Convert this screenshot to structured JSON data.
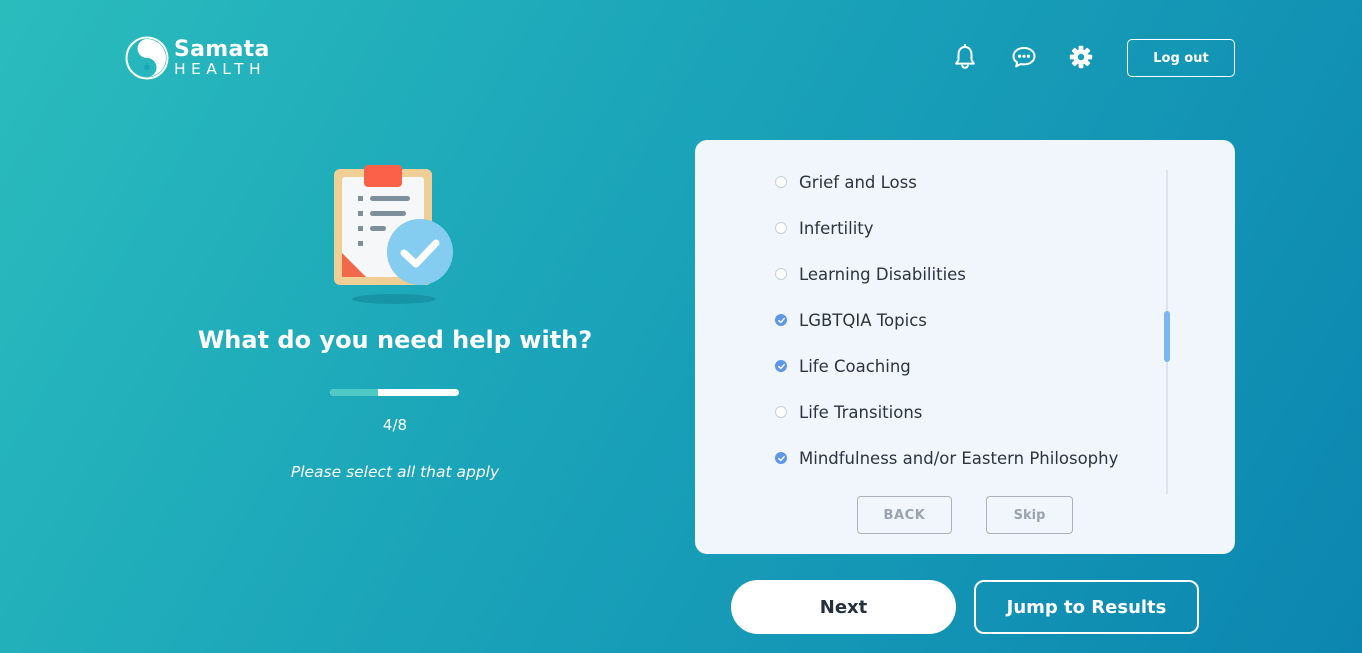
{
  "brand": {
    "name": "Samata",
    "subtitle": "HEALTH"
  },
  "header": {
    "icons": [
      "bell-icon",
      "chat-icon",
      "gear-icon"
    ],
    "logout_label": "Log out"
  },
  "questionnaire": {
    "heading": "What do you need help with?",
    "progress": {
      "current": 4,
      "total": 8,
      "fraction": 0.375,
      "label": "4/8"
    },
    "hint": "Please select all that apply"
  },
  "options": [
    {
      "label": "Grief and Loss",
      "checked": false
    },
    {
      "label": "Infertility",
      "checked": false
    },
    {
      "label": "Learning Disabilities",
      "checked": false
    },
    {
      "label": "LGBTQIA Topics",
      "checked": true
    },
    {
      "label": "Life Coaching",
      "checked": true
    },
    {
      "label": "Life Transitions",
      "checked": false
    },
    {
      "label": "Mindfulness and/or Eastern Philosophy",
      "checked": true
    }
  ],
  "card_buttons": {
    "back_label": "BACK",
    "skip_label": "Skip"
  },
  "actions": {
    "next_label": "Next",
    "jump_label": "Jump to Results"
  },
  "colors": {
    "gradient_start": "#2abcbd",
    "gradient_end": "#0c86b0",
    "check_accent": "#5e97e8",
    "progress_fill": "#4ec9c3",
    "card_background": "#f1f6fd"
  }
}
